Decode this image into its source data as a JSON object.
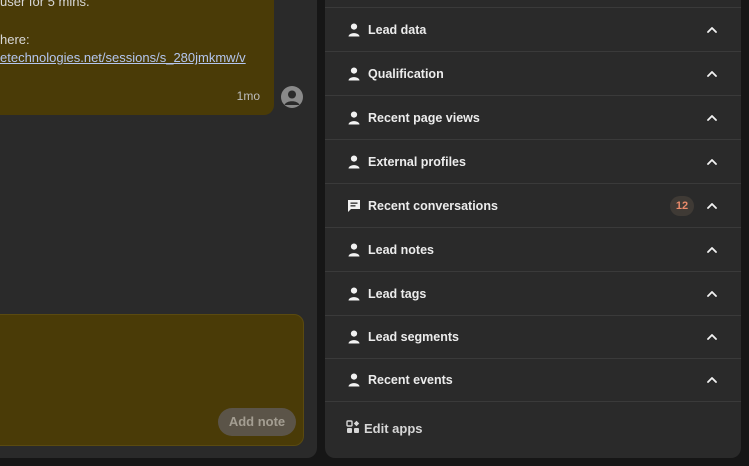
{
  "conversation": {
    "note_line1": "user for 5 mins.",
    "note_line2": "here:",
    "note_link": "etechnologies.net/sessions/s_280jmkmw/v",
    "timestamp": "1mo",
    "add_note_label": "Add note"
  },
  "sidebar": {
    "sections": [
      {
        "label": "Lead data",
        "icon": "person-icon"
      },
      {
        "label": "Qualification",
        "icon": "person-icon"
      },
      {
        "label": "Recent page views",
        "icon": "person-icon"
      },
      {
        "label": "External profiles",
        "icon": "person-icon"
      },
      {
        "label": "Recent conversations",
        "icon": "chat-icon",
        "badge": "12"
      },
      {
        "label": "Lead notes",
        "icon": "person-icon"
      },
      {
        "label": "Lead tags",
        "icon": "person-icon"
      },
      {
        "label": "Lead segments",
        "icon": "person-icon"
      },
      {
        "label": "Recent events",
        "icon": "person-icon"
      }
    ],
    "edit_apps_label": "Edit apps"
  },
  "colors": {
    "note_background": "#4a3b07",
    "pane_background": "#2a2a2a",
    "badge_text": "#e98a6a"
  }
}
